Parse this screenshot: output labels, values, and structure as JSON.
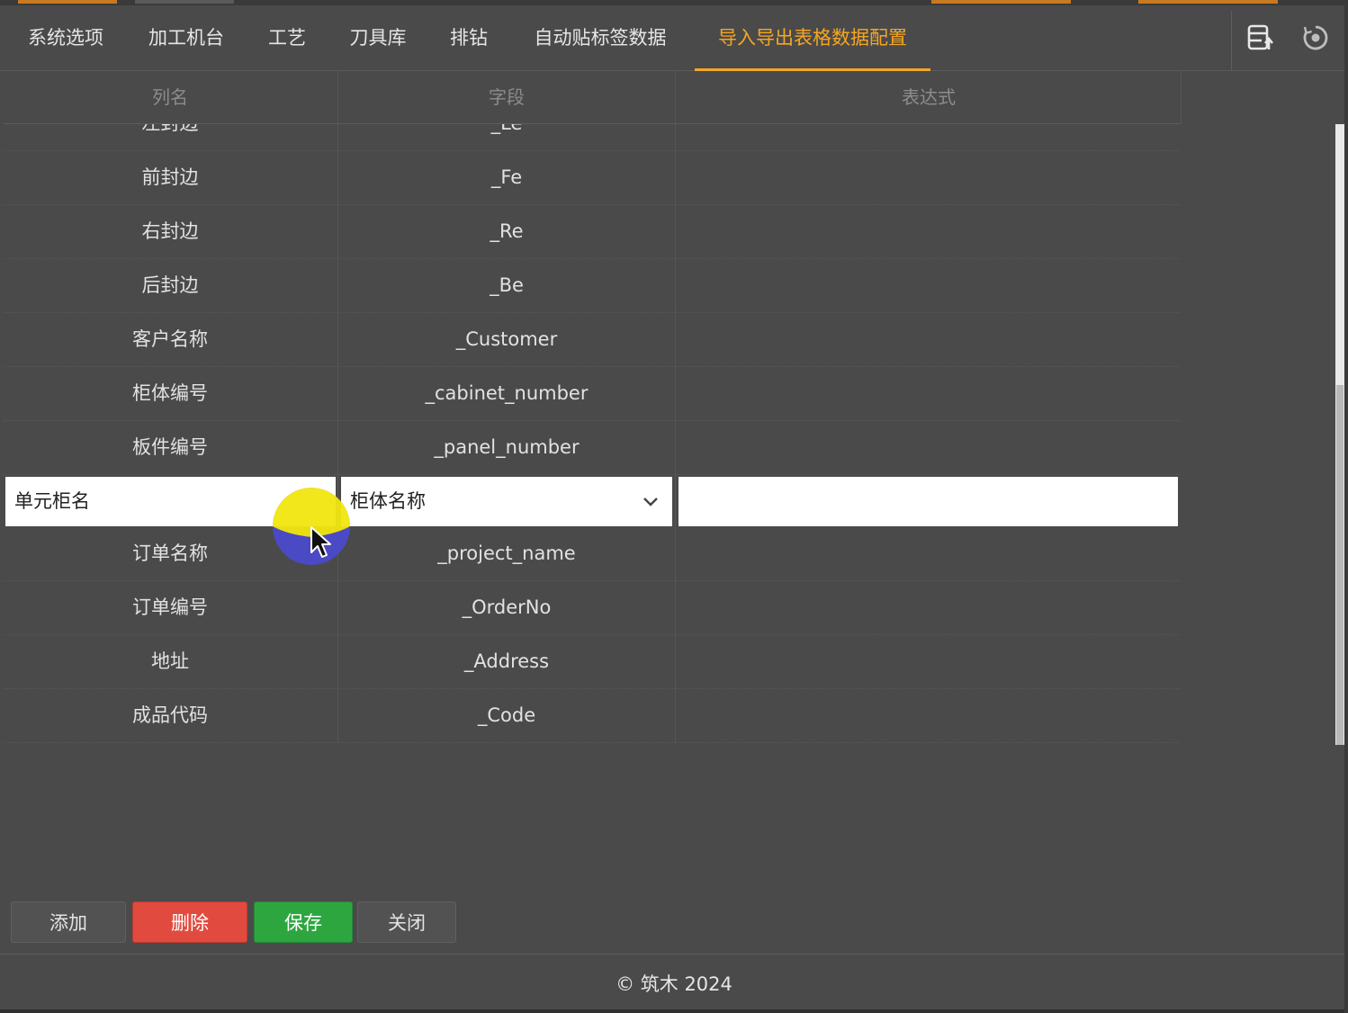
{
  "nav": {
    "tabs": [
      {
        "label": "系统选项"
      },
      {
        "label": "加工机台"
      },
      {
        "label": "工艺"
      },
      {
        "label": "刀具库"
      },
      {
        "label": "排钻"
      },
      {
        "label": "自动贴标签数据"
      },
      {
        "label": "导入导出表格数据配置",
        "active": true
      }
    ],
    "icons": [
      "export-list-icon",
      "reset-circle-icon"
    ]
  },
  "table": {
    "headers": [
      "列名",
      "字段",
      "表达式"
    ],
    "rows_before_edit": [
      {
        "name": "左封边",
        "field": "_Le",
        "expr": ""
      },
      {
        "name": "前封边",
        "field": "_Fe",
        "expr": ""
      },
      {
        "name": "右封边",
        "field": "_Re",
        "expr": ""
      },
      {
        "name": "后封边",
        "field": "_Be",
        "expr": ""
      },
      {
        "name": "客户名称",
        "field": "_Customer",
        "expr": ""
      },
      {
        "name": "柜体编号",
        "field": "_cabinet_number",
        "expr": ""
      },
      {
        "name": "板件编号",
        "field": "_panel_number",
        "expr": ""
      }
    ],
    "edit_row": {
      "name_value": "单元柜名",
      "field_selected": "柜体名称",
      "expr_value": ""
    },
    "rows_after_edit": [
      {
        "name": "订单名称",
        "field": "_project_name",
        "expr": ""
      },
      {
        "name": "订单编号",
        "field": "_OrderNo",
        "expr": ""
      },
      {
        "name": "地址",
        "field": "_Address",
        "expr": ""
      },
      {
        "name": "成品代码",
        "field": "_Code",
        "expr": ""
      }
    ]
  },
  "buttons": {
    "add": "添加",
    "delete": "删除",
    "save": "保存",
    "close": "关闭"
  },
  "footer": {
    "text": "© 筑木 2024"
  },
  "colors": {
    "accent": "#f5a623",
    "danger": "#e14b3f",
    "success": "#2ea640",
    "background": "#4a4a4a"
  }
}
